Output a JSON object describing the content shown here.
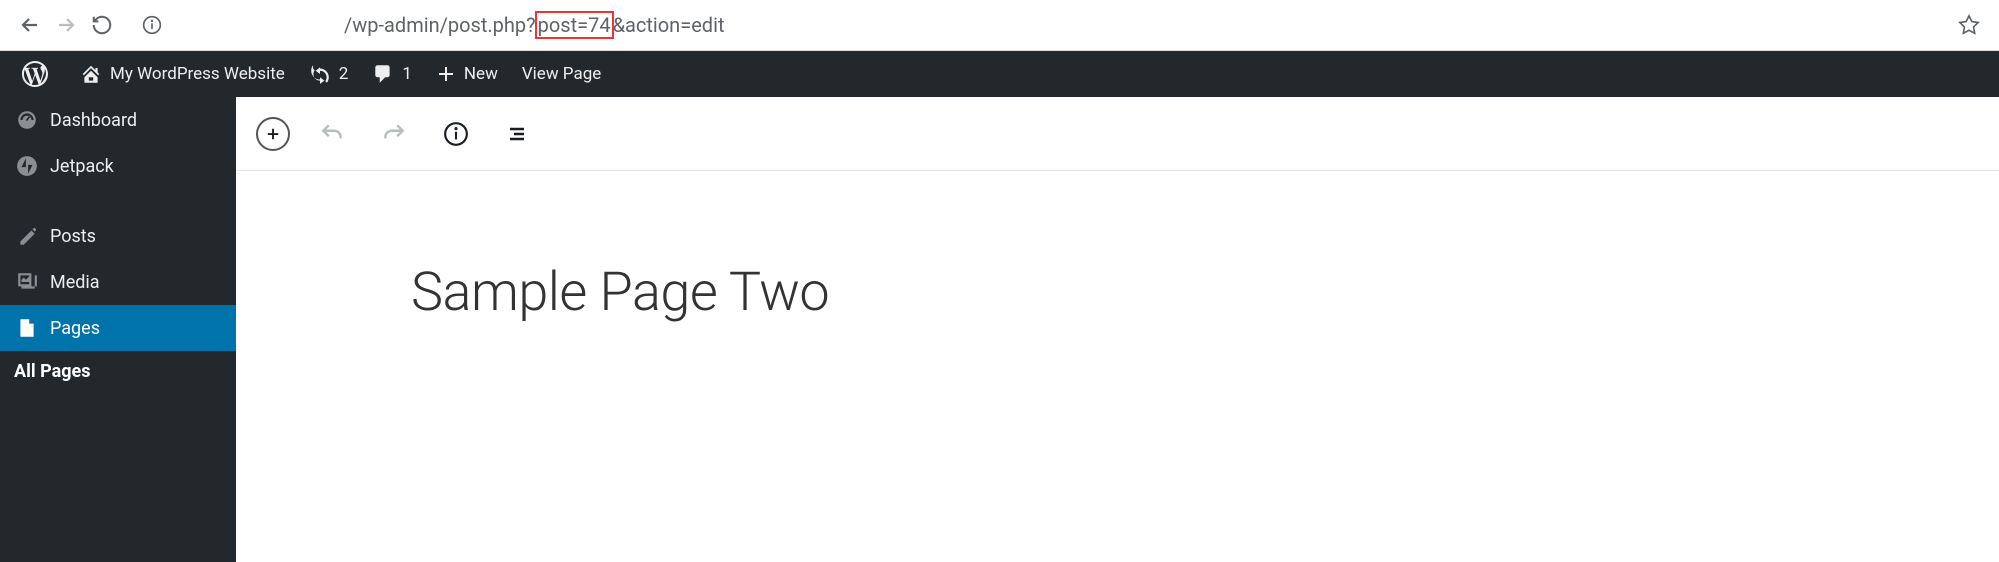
{
  "browser": {
    "url_prefix": "/wp-admin/post.php?",
    "url_highlight": "post=74",
    "url_suffix": "&action=edit"
  },
  "adminbar": {
    "site_title": "My WordPress Website",
    "updates_count": "2",
    "comments_count": "1",
    "new_label": "New",
    "view_label": "View Page"
  },
  "sidebar": {
    "dashboard": "Dashboard",
    "jetpack": "Jetpack",
    "posts": "Posts",
    "media": "Media",
    "pages": "Pages",
    "all_pages": "All Pages"
  },
  "editor": {
    "title": "Sample Page Two"
  }
}
